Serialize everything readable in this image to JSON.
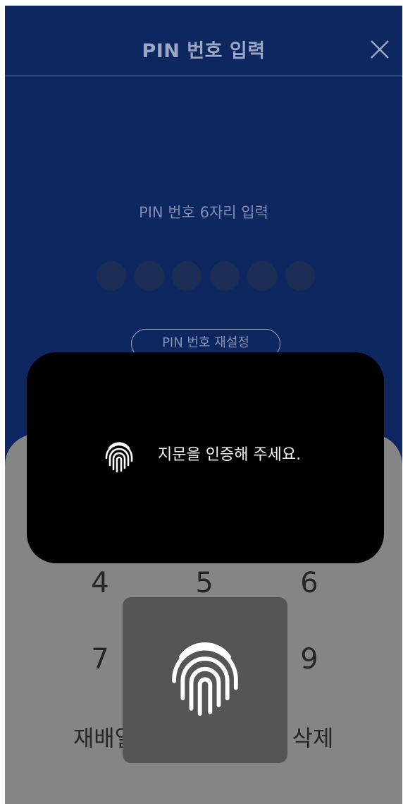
{
  "header": {
    "title": "PIN 번호 입력",
    "close_icon": "close-icon"
  },
  "pin": {
    "prompt": "PIN 번호 6자리 입력",
    "length": 6,
    "entered": 0,
    "reset_label": "PIN 번호 재설정"
  },
  "keypad": {
    "row2": [
      "4",
      "5",
      "6"
    ],
    "row3": [
      "7",
      "",
      "9"
    ],
    "bottom_left": "재배열",
    "bottom_right": "삭제"
  },
  "fingerprint_toast": {
    "icon": "fingerprint-icon",
    "message": "지문을 인증해 주세요."
  },
  "fingerprint_sensor": {
    "icon": "fingerprint-icon"
  },
  "colors": {
    "background": "#0e2761",
    "keypad": "#858585",
    "toast": "#000000",
    "sensor_panel": "#555555"
  }
}
